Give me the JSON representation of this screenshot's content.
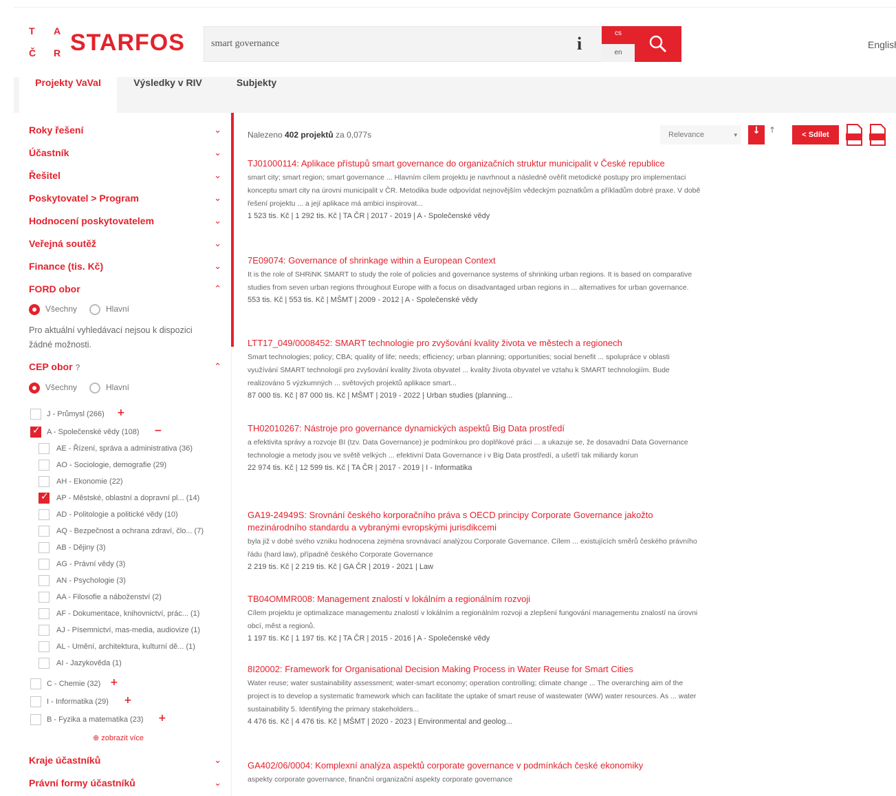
{
  "header": {
    "logo_letters": [
      "T",
      "A",
      "Č",
      "R"
    ],
    "logo_text": "STARFOS",
    "search_value": "smart governance",
    "lang_cs": "cs",
    "lang_en": "en",
    "english_link": "English"
  },
  "tabs": [
    {
      "label": "Projekty VaVaI"
    },
    {
      "label": "Výsledky v RIV"
    },
    {
      "label": "Subjekty"
    }
  ],
  "sidebar": {
    "facets": [
      {
        "label": "Roky řešení"
      },
      {
        "label": "Účastník"
      },
      {
        "label": "Řešitel"
      },
      {
        "label": "Poskytovatel > Program"
      },
      {
        "label": "Hodnocení poskytovatelem"
      },
      {
        "label": "Veřejná soutěž"
      },
      {
        "label": "Finance (tis. Kč)"
      },
      {
        "label": "FORD obor"
      }
    ],
    "ford_radio": {
      "all": "Všechny",
      "main": "Hlavní"
    },
    "ford_note": "Pro aktuální vyhledávací nejsou k dispozici žádné možnosti.",
    "cep_label": "CEP obor",
    "cep_radio": {
      "all": "Všechny",
      "main": "Hlavní"
    },
    "cep_items": [
      {
        "label": "J - Průmysl (266)",
        "level": 0,
        "checked": false,
        "sign": "+"
      },
      {
        "label": "A - Společenské vědy (108)",
        "level": 0,
        "checked": true,
        "sign": "−"
      },
      {
        "label": "AE - Řízení, správa a administrativa (36)",
        "level": 1,
        "checked": false
      },
      {
        "label": "AO - Sociologie, demografie (29)",
        "level": 1,
        "checked": false
      },
      {
        "label": "AH - Ekonomie (22)",
        "level": 1,
        "checked": false
      },
      {
        "label": "AP - Městské, oblastní a dopravní pl... (14)",
        "level": 1,
        "checked": true
      },
      {
        "label": "AD - Politologie a politické vědy (10)",
        "level": 1,
        "checked": false
      },
      {
        "label": "AQ - Bezpečnost a ochrana zdraví, člo... (7)",
        "level": 1,
        "checked": false
      },
      {
        "label": "AB - Dějiny (3)",
        "level": 1,
        "checked": false
      },
      {
        "label": "AG - Právní vědy (3)",
        "level": 1,
        "checked": false
      },
      {
        "label": "AN - Psychologie (3)",
        "level": 1,
        "checked": false
      },
      {
        "label": "AA - Filosofie a náboženství (2)",
        "level": 1,
        "checked": false
      },
      {
        "label": "AF - Dokumentace, knihovnictví, prác... (1)",
        "level": 1,
        "checked": false
      },
      {
        "label": "AJ - Písemnictví, mas-media, audiovize (1)",
        "level": 1,
        "checked": false
      },
      {
        "label": "AL - Umění, architektura, kulturní dě... (1)",
        "level": 1,
        "checked": false
      },
      {
        "label": "AI - Jazykověda (1)",
        "level": 1,
        "checked": false
      },
      {
        "label": "C - Chemie (32)",
        "level": 0,
        "checked": false,
        "sign": "+"
      },
      {
        "label": "I - Informatika (29)",
        "level": 0,
        "checked": false,
        "sign": "+"
      },
      {
        "label": "B - Fyzika a matematika (23)",
        "level": 0,
        "checked": false,
        "sign": "+"
      }
    ],
    "more_link": "⊕ zobrazit více",
    "bottom_facets": [
      {
        "label": "Kraje účastníků"
      },
      {
        "label": "Právní formy účastníků"
      }
    ]
  },
  "results_header": {
    "found_prefix": "Nalezeno",
    "found_count": "402 projektů",
    "found_suffix": "za 0,077s",
    "sort_value": "Relevance",
    "share_label": "Sdílet"
  },
  "results": [
    {
      "title": "TJ01000114: Aplikace přístupů smart governance do organizačních struktur municipalit v České republice",
      "snippet": "smart city; smart region; smart governance ... Hlavním cílem projektu je navrhnout a následně ověřit metodické postupy pro implementaci konceptu smart city na úrovni municipalit v ČR. Metodika bude odpovídat nejnovějším vědeckým poznatkům a příkladům dobré praxe. V době řešení projektu ... a její aplikace má ambici inspirovat...",
      "meta": "1 523 tis. Kč | 1 292 tis. Kč | TA ČR | 2017 - 2019 | A - Společenské vědy"
    },
    {
      "title": "7E09074: Governance of shrinkage within a European Context",
      "snippet": "It is the role of SHRiNK SMART to study the role of policies and governance systems of shrinking urban regions. It is based on comparative studies from seven urban regions throughout Europe with a focus on disadvantaged urban regions in ... alternatives for urban governance.",
      "meta": "553 tis. Kč | 553 tis. Kč | MŠMT | 2009 - 2012 | A - Společenské vědy"
    },
    {
      "title": "LTT17_049/0008452: SMART technologie pro zvyšování kvality života ve městech a regionech",
      "snippet": "Smart technologies; policy; CBA; quality of life; needs; efficiency; urban planning; opportunities; social benefit ... spolupráce v oblasti využívání SMART technologií pro zvyšování kvality života obyvatel ... kvality života obyvatel ve vztahu k SMART technologiím. Bude realizováno 5 výzkumných ... světových projektů aplikace smart...",
      "meta": "87 000 tis. Kč | 87 000 tis. Kč | MŠMT | 2019 - 2022 | Urban studies (planning..."
    },
    {
      "title": "TH02010267: Nástroje pro governance dynamických aspektů Big Data prostředí",
      "snippet": "a efektivita správy a rozvoje BI (tzv. Data Governance) je podmínkou pro doplňkové práci ... a ukazuje se, že dosavadní Data Governance technologie a metody jsou ve světě velkých ... efektivní Data Governance i v Big Data prostředí, a ušetří tak miliardy korun",
      "meta": "22 974 tis. Kč | 12 599 tis. Kč | TA ČR | 2017 - 2019 | I - Informatika"
    },
    {
      "title": "GA19-24949S: Srovnání českého korporačního práva s OECD principy Corporate Governance jakožto mezinárodního standardu a vybranými evropskými jurisdikcemi",
      "snippet": "byla již v dobé svého vzniku hodnocena zejména srovnávací analýzou Corporate Governance. Cílem ... existujících směrů českého právního řádu (hard law), případně českého Corporate Governance",
      "meta": "2 219 tis. Kč | 2 219 tis. Kč | GA ČR | 2019 - 2021 | Law"
    },
    {
      "title": "TB04OMMR008: Management znalostí v lokálním a regionálním rozvoji",
      "snippet": "Cílem projektu je optimalizace managementu znalostí v lokálním a regionálním rozvoji a zlepšení fungování managementu znalostí na úrovni obcí, měst a regionů.",
      "meta": "1 197 tis. Kč | 1 197 tis. Kč | TA ČR | 2015 - 2016 | A - Společenské vědy"
    },
    {
      "title": "8I20002: Framework for Organisational Decision Making Process in Water Reuse for Smart Cities",
      "snippet": "Water reuse; water sustainability assessment; water-smart economy; operation controlling; climate change ... The overarching aim of the project is to develop a systematic framework which can facilitate the uptake of smart reuse of wastewater (WW) water resources. As ... water sustainability 5. Identifying the primary stakeholders...",
      "meta": "4 476 tis. Kč | 4 476 tis. Kč | MŠMT | 2020 - 2023 | Environmental and geolog..."
    },
    {
      "title": "GA402/06/0004: Komplexní analýza aspektů corporate governance v podmínkách české ekonomiky",
      "snippet": "aspekty corporate governance, finanční organizační aspekty corporate governance",
      "meta": ""
    }
  ]
}
